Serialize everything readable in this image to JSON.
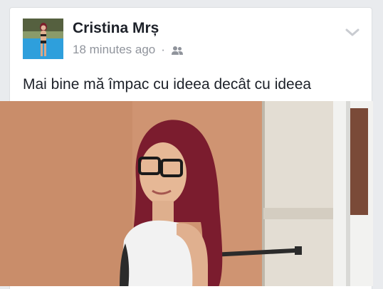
{
  "post": {
    "author_name": "Cristina Mrș",
    "timestamp": "18 minutes ago",
    "separator": "·",
    "audience_icon": "friends-icon",
    "menu_icon": "chevron-down-icon",
    "status_text": "Mai bine mă împac cu ideea decât cu ideea"
  },
  "colors": {
    "name": "#1d2129",
    "meta": "#90949c",
    "background": "#e9ebee"
  }
}
